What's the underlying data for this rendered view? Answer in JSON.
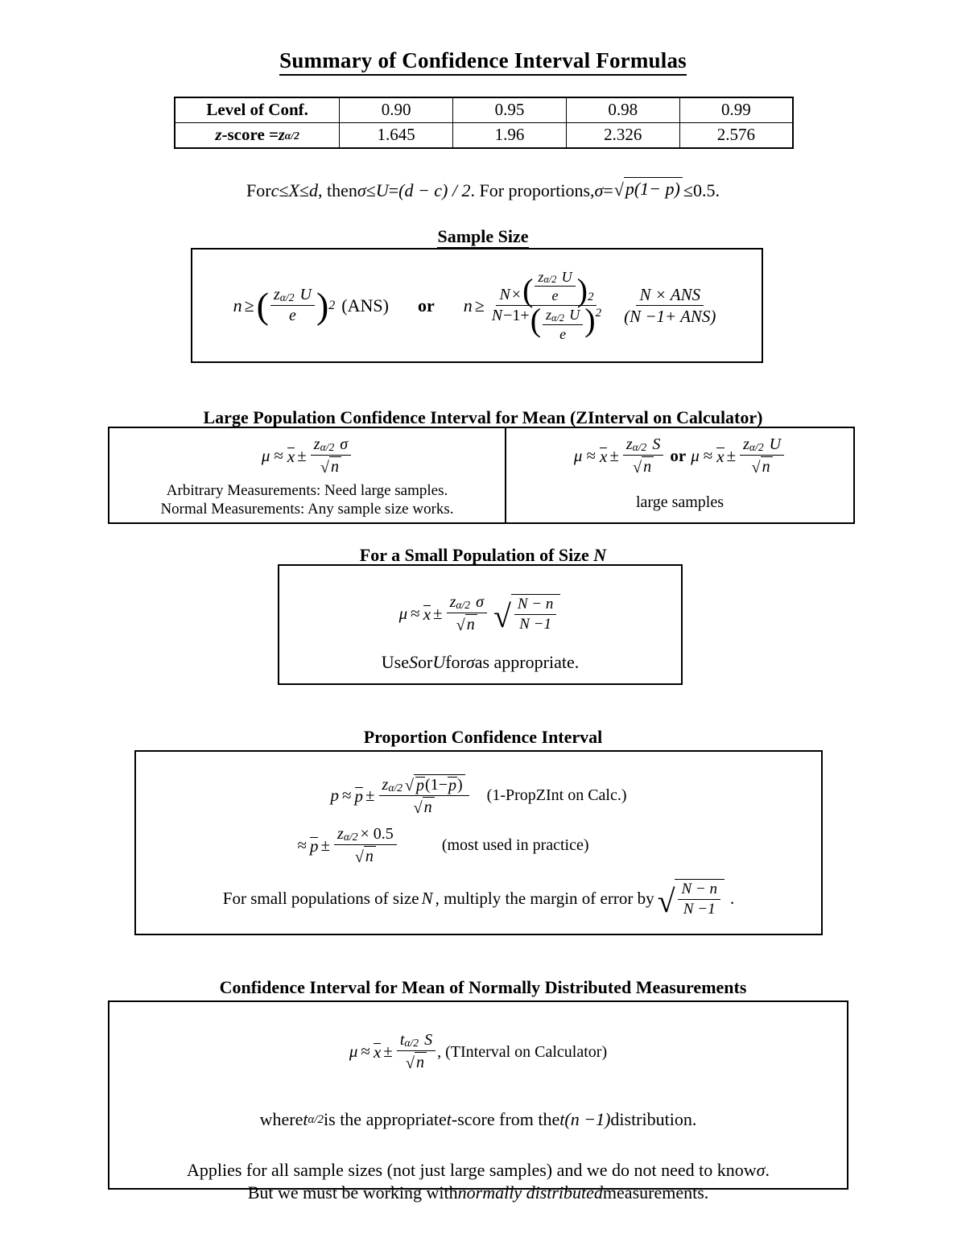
{
  "page": {
    "title": "Summary of Confidence Interval Formulas"
  },
  "z_table": {
    "row_labels": [
      "Level of Conf.",
      "z-score = "
    ],
    "row1_label": "Level of Conf.",
    "row2_label_prefix": "z",
    "row2_label_mid": "-score = ",
    "row2_label_sym": "z",
    "row2_label_sub": "α/2",
    "confidence_levels": [
      "0.90",
      "0.95",
      "0.98",
      "0.99"
    ],
    "z_scores": [
      "1.645",
      "1.96",
      "2.326",
      "2.576"
    ]
  },
  "sigma_line": {
    "t1": "For ",
    "c": "c",
    "le1": " ≤ ",
    "X": "X",
    "le2": " ≤ ",
    "d": "d",
    "t2": ", then ",
    "sigma": "σ",
    "le3": " ≤ ",
    "U": "U",
    "eq": " = ",
    "expr": "(d − c) / 2",
    "t3": ".  For proportions, ",
    "sigma2": "σ",
    "eq2": " = ",
    "radicand": "p(1− p)",
    "le4": " ≤ ",
    "bound": "0.5."
  },
  "sample_size": {
    "caption": "Sample Size",
    "n": "n",
    "geq": "≥",
    "z": "z",
    "alpha_over_2": "α/2",
    "U": "U",
    "e": "e",
    "power": "2",
    "ans_label": "(ANS)",
    "or_label": "or",
    "N": "N",
    "times": "×",
    "minus_one": "−1+",
    "ans": "ANS",
    "right_num": "N × ANS",
    "right_den": "(N −1+ ANS)"
  },
  "large_population": {
    "caption": "Large Population Confidence Interval for Mean (ZInterval on Calculator)",
    "left": {
      "mu": "μ",
      "approx": "≈",
      "xbar": "x",
      "pm": "±",
      "z": "z",
      "alpha_over_2": "α/2",
      "sigma": "σ",
      "sqrt_n": "n",
      "note_line1": "Arbitrary Measurements:  Need large samples.",
      "note_line2": "Normal Measurements:  Any sample size works."
    },
    "right": {
      "mu": "μ",
      "approx": "≈",
      "xbar": "x",
      "pm": "±",
      "z": "z",
      "alpha_over_2": "α/2",
      "S": "S",
      "U": "U",
      "or_label": "or",
      "sqrt_n": "n",
      "note": "large samples"
    }
  },
  "small_population": {
    "caption": "For a Small Population of Size N",
    "caption_plain": "For a Small Population of Size ",
    "caption_N": "N",
    "mu": "μ",
    "approx": "≈",
    "xbar": "x",
    "pm": "±",
    "z": "z",
    "alpha_over_2": "α/2",
    "sigma": "σ",
    "sqrt_n": "n",
    "fpc_num": "N − n",
    "fpc_den": "N −1",
    "note_pre": "Use ",
    "note_S": "S",
    "note_mid": " or ",
    "note_U": "U",
    "note_mid2": " for ",
    "note_sigma": "σ",
    "note_post": " as appropriate."
  },
  "proportion": {
    "caption": "Proportion Confidence Interval",
    "line1": {
      "p": "p",
      "approx": "≈",
      "pbar": "p",
      "pm": "±",
      "z": "z",
      "alpha_over_2": "α/2",
      "radicand": "p(1− p)",
      "sqrt_n": "n",
      "note": "(1-PropZInt on Calc.)"
    },
    "line2": {
      "approx": "≈",
      "pbar": "p",
      "pm": "±",
      "z": "z",
      "alpha_over_2": "α/2",
      "times_half": "× 0.5",
      "sqrt_n": "n",
      "note": "(most used in practice)"
    },
    "line3": {
      "pre": "For small populations of size ",
      "N": "N",
      "mid": ", multiply the margin of error by ",
      "fpc_num": "N − n",
      "fpc_den": "N −1",
      "post": "."
    }
  },
  "normal_mean": {
    "caption": "Confidence Interval for Mean of Normally Distributed  Measurements",
    "formula": {
      "mu": "μ",
      "approx": "≈",
      "xbar": "x",
      "pm": "±",
      "t": "t",
      "alpha_over_2": "α/2",
      "S": "S",
      "sqrt_n": "n",
      "note": ", (TInterval on Calculator)"
    },
    "where_line": {
      "pre": "where ",
      "t": "t",
      "alpha_over_2": "α/2",
      "mid": " is the appropriate ",
      "t2": "t",
      "mid2": "-score from the ",
      "t3": "t",
      "dist": "(n −1)",
      "post": " distribution."
    },
    "footer_line1_pre": "Applies for all sample sizes (not just large samples) and we do not need to know ",
    "footer_line1_sigma": "σ",
    "footer_line1_post": ".",
    "footer_line2_pre": "But we must be working with ",
    "footer_line2_em": "normally distributed",
    "footer_line2_post": " measurements."
  },
  "colors": {
    "ink": "#000000",
    "paper": "#ffffff"
  }
}
